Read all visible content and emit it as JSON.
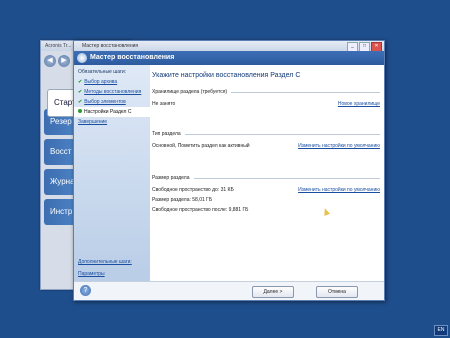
{
  "background_app": {
    "title": "Acronis Tr...",
    "tabs": [
      "Старто",
      "Резер",
      "Восст",
      "Журна",
      "Инстр"
    ]
  },
  "wizard": {
    "window_title": "Мастер восстановления",
    "header_title": "Мастер восстановления",
    "sidebar": {
      "group_label": "Обязательные шаги:",
      "steps": [
        {
          "label": "Выбор архива",
          "done": true
        },
        {
          "label": "Методы восстановления",
          "done": true
        },
        {
          "label": "Выбор элементов",
          "done": true
        },
        {
          "label": "Настройки Раздел C",
          "current": true
        }
      ],
      "finish_label": "Завершение",
      "optional_group": "Дополнительные шаги:",
      "params_label": "Параметры"
    },
    "content": {
      "title": "Укажите настройки восстановления Раздел C",
      "storage": {
        "section": "Хранилище раздела (требуется)",
        "value": "Не занято",
        "link": "Новое хранилище"
      },
      "partition_type": {
        "section": "Тип раздела",
        "value": "Основной, Пометить раздел как активный",
        "link": "Изменить настройки по умолчанию"
      },
      "partition_size": {
        "section": "Размер раздела",
        "free_before": "Свободное пространство до: 31 КБ",
        "size": "Размер раздела: 58,01 ГБ",
        "free_after": "Свободное пространство после: 9,881 ГБ",
        "link": "Изменить настройки по умолчанию"
      }
    },
    "buttons": {
      "next": "Далее >",
      "cancel": "Отмена"
    }
  },
  "taskbar": {
    "lang": "EN"
  },
  "colors": {
    "desktop": "#1f4e8c",
    "header": "#2d5a9e",
    "link": "#1a4ea0"
  }
}
